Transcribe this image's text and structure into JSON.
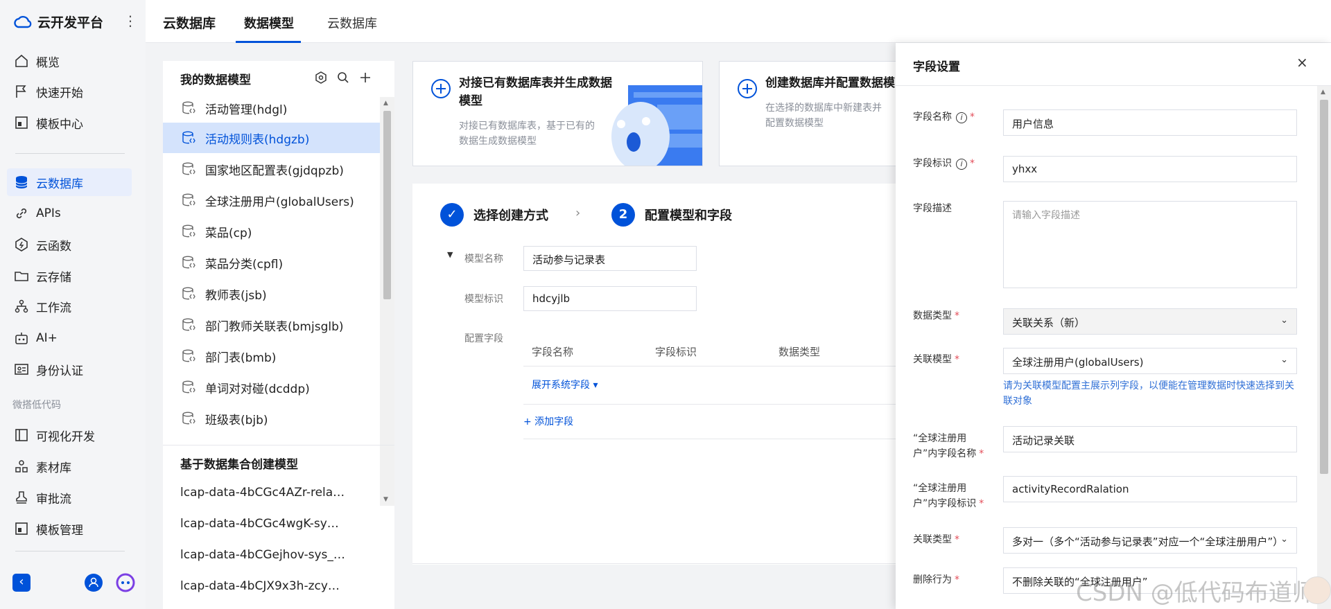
{
  "brand": {
    "name": "云开发平台",
    "more": "⋮"
  },
  "nav": {
    "items": [
      {
        "label": "概览",
        "icon": "home-icon"
      },
      {
        "label": "快速开始",
        "icon": "flag-icon"
      },
      {
        "label": "模板中心",
        "icon": "template-icon"
      },
      {
        "label": "云数据库",
        "icon": "database-icon",
        "active": true
      },
      {
        "label": "APIs",
        "icon": "link-icon"
      },
      {
        "label": "云函数",
        "icon": "function-icon"
      },
      {
        "label": "云存储",
        "icon": "folder-icon"
      },
      {
        "label": "工作流",
        "icon": "workflow-icon"
      },
      {
        "label": "AI+",
        "icon": "robot-icon"
      },
      {
        "label": "身份认证",
        "icon": "id-card-icon"
      },
      {
        "label": "可视化开发",
        "icon": "layout-icon"
      },
      {
        "label": "素材库",
        "icon": "assets-icon"
      },
      {
        "label": "审批流",
        "icon": "stamp-icon"
      },
      {
        "label": "模板管理",
        "icon": "template-manage-icon"
      }
    ],
    "group_label": "微搭低代码"
  },
  "topbar": {
    "title": "云数据库",
    "tabs": [
      {
        "label": "数据模型",
        "active": true
      },
      {
        "label": "云数据库",
        "active": false
      }
    ]
  },
  "model_panel": {
    "title": "我的数据模型",
    "models": [
      {
        "label": "活动管理(hdgl)"
      },
      {
        "label": "活动规则表(hdgzb)",
        "active": true
      },
      {
        "label": "国家地区配置表(gjdqpzb)"
      },
      {
        "label": "全球注册用户(globalUsers)"
      },
      {
        "label": "菜品(cp)"
      },
      {
        "label": "菜品分类(cpfl)"
      },
      {
        "label": "教师表(jsb)"
      },
      {
        "label": "部门教师关联表(bmjsglb)"
      },
      {
        "label": "部门表(bmb)"
      },
      {
        "label": "单词对对碰(dcddp)"
      },
      {
        "label": "班级表(bjb)"
      }
    ],
    "dataset_title": "基于数据集合创建模型",
    "datasets": [
      "lcap-data-4bCGc4AZr-rela…",
      "lcap-data-4bCGc4wgK-sy…",
      "lcap-data-4bCGejhov-sys_…",
      "lcap-data-4bCJX9x3h-zcy…"
    ]
  },
  "cards": [
    {
      "title": "对接已有数据库表并生成数据模型",
      "desc": "对接已有数据库表，基于已有的数据生成数据模型"
    },
    {
      "title": "创建数据库并配置数据模",
      "desc": "在选择的数据库中新建表并配置数据模型"
    }
  ],
  "steps": [
    {
      "index": "✓",
      "label": "选择创建方式"
    },
    {
      "index": "2",
      "label": "配置模型和字段"
    }
  ],
  "form": {
    "model_name_label": "模型名称",
    "model_name_value": "活动参与记录表",
    "model_id_label": "模型标识",
    "model_id_value": "hdcyjlb",
    "config_label": "配置字段",
    "columns": [
      "字段名称",
      "字段标识",
      "数据类型"
    ],
    "expand_link": "展开系统字段 ▾",
    "add_field": "+ 添加字段"
  },
  "drawer": {
    "title": "字段设置",
    "close": "×",
    "field_name_label": "字段名称",
    "field_name_value": "用户信息",
    "field_id_label": "字段标识",
    "field_id_value": "yhxx",
    "field_desc_label": "字段描述",
    "field_desc_placeholder": "请输入字段描述",
    "data_type_label": "数据类型",
    "data_type_value": "关联关系（新）",
    "rel_model_label": "关联模型",
    "rel_model_value": "全球注册用户(globalUsers)",
    "rel_hint": "请为关联模型配置主展示列字段，以便能在管理数据时快速选择到关联对象",
    "inner_name_label": "“全球注册用户”内字段名称",
    "inner_name_value": "活动记录关联",
    "inner_id_label": "“全球注册用户”内字段标识",
    "inner_id_value": "activityRecordRalation",
    "rel_type_label": "关联类型",
    "rel_type_value": "多对一（多个“活动参与记录表”对应一个“全球注册用户”）",
    "delete_label": "删除行为",
    "delete_value": "不删除关联的“全球注册用户”"
  },
  "watermark": "CSDN @低代码布道师",
  "colors": {
    "accent": "#0052d9",
    "active_bg": "#d4e3fc",
    "required": "#e34d59",
    "hint": "#2f6fd6"
  }
}
